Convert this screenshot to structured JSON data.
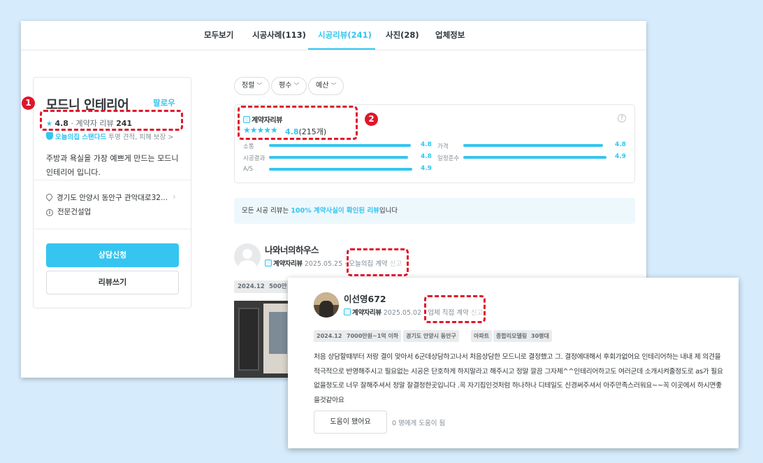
{
  "tabs": [
    {
      "label": "모두보기"
    },
    {
      "label": "시공사례(113)"
    },
    {
      "label": "시공리뷰(241)"
    },
    {
      "label": "사진(28)"
    },
    {
      "label": "업체정보"
    }
  ],
  "company": {
    "name": "모드니 인테리어",
    "follow_label": "팔로우",
    "rating": "4.8",
    "review_label": "· 계약자 리뷰",
    "review_count": "241",
    "standard_label": "오늘의집 스탠다드",
    "standard_desc": "투명 견적, 피해 보장",
    "description": "주방과 욕실을 가장 예쁘게 만드는 모드니 인테리어 입니다.",
    "address": "경기도 안양시 동안구 관악대로32...",
    "license": "전문건설업",
    "consult_button": "상담신청",
    "write_review_button": "리뷰쓰기"
  },
  "filters": [
    "정렬",
    "평수",
    "예산"
  ],
  "summary": {
    "title": "계약자리뷰",
    "stars": "★★★★★",
    "score": "4.8",
    "count": "(215개)",
    "criteria": [
      {
        "label": "소통",
        "value": "4.8"
      },
      {
        "label": "가격",
        "value": "4.8"
      },
      {
        "label": "시공결과",
        "value": "4.8"
      },
      {
        "label": "일정준수",
        "value": "4.9"
      },
      {
        "label": "A/S",
        "value": "4.9"
      }
    ]
  },
  "notice": {
    "prefix": "모든 시공 리뷰는 ",
    "highlight": "100% 계약사실이 확인된 리뷰",
    "suffix": "입니다"
  },
  "review1": {
    "name": "나와너의하우스",
    "badge": "계약자리뷰",
    "date": "2025.05.25",
    "contract": "· 오늘의집 계약",
    "report": "신고",
    "tags": [
      "2024.12",
      "500만"
    ]
  },
  "review2": {
    "name": "이선영672",
    "badge": "계약자리뷰",
    "date": "2025.05.02",
    "contract": "· 업체 직접 계약",
    "report": "신고",
    "tags": [
      "2024.12",
      "7000만원~1억 이하",
      "경기도 안양시 동안구",
      "아파트",
      "종합리모델링",
      "30평대"
    ],
    "body": "처음 상담할때부터 저랑 결이 맞아서 6군데상담하고나서 처음상담한 모드니로 결정했고 그. 결정에대해서 후회가없어요 인테리어하는 내내 제 의견을적극적으로 반영해주시고 필요없는 시공은 단호하게 하지말라고 해주시고 정말 깔끔 그자체^^인테리어하고도 여러군데 소개시켜줄정도로 as가 필요없을정도로 너무 잘해주셔서 정말 잘결정한곳입니다 .꼭 자기집인것처럼 하나하나 디테일도 신경써주셔서 아주만족스러워요~~꼭 이곳에서 하시면좋을것같아요",
    "helpful_button": "도움이 됐어요",
    "helpful_count": "0 명에게 도움이 됨"
  },
  "annotations": [
    "1",
    "2"
  ],
  "colors": {
    "accent": "#35c5f0",
    "annotation": "#e0162b",
    "background": "#d6ebfb"
  }
}
